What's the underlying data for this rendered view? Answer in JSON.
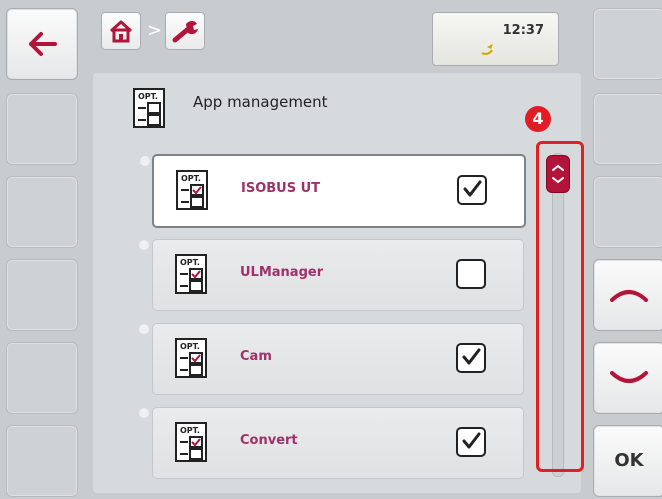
{
  "header": {
    "time": "12:37"
  },
  "page": {
    "title": "App management"
  },
  "apps": [
    {
      "label": "ISOBUS UT",
      "checked": true,
      "selected": true
    },
    {
      "label": "ULManager",
      "checked": false,
      "selected": false
    },
    {
      "label": "Cam",
      "checked": true,
      "selected": false
    },
    {
      "label": "Convert",
      "checked": true,
      "selected": false
    }
  ],
  "callout": {
    "label": "4"
  },
  "nav": {
    "ok_label": "OK"
  },
  "colors": {
    "accent": "#a0306a",
    "thumb": "#b3143a",
    "callout": "#e21c24"
  },
  "icons": {
    "back": "arrow-left-icon",
    "home": "home-icon",
    "settings": "wrench-icon",
    "status": "satellite-icon",
    "app": "opt-app-icon",
    "up": "chevron-up-icon",
    "down": "chevron-down-icon"
  }
}
